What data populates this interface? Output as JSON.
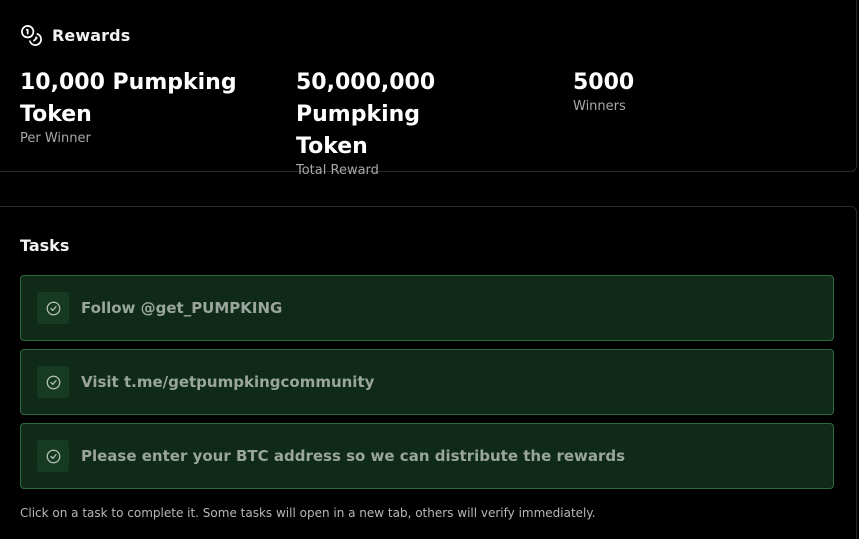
{
  "rewards": {
    "title": "Rewards",
    "icon": "coins-icon",
    "stats": [
      {
        "value_line1": "10,000 Pumpking",
        "value_line2": "Token",
        "label": "Per Winner"
      },
      {
        "value_line1": "50,000,000 Pumpking",
        "value_line2": "Token",
        "label": "Total Reward"
      },
      {
        "value_line1": "5000",
        "value_line2": "",
        "label": "Winners"
      }
    ]
  },
  "tasks": {
    "title": "Tasks",
    "items": [
      {
        "label": "Follow @get_PUMPKING",
        "icon": "check-circle-icon"
      },
      {
        "label": "Visit t.me/getpumpkingcommunity",
        "icon": "check-circle-icon"
      },
      {
        "label": "Please enter your BTC address so we can distribute the rewards",
        "icon": "check-circle-icon"
      }
    ],
    "footnote": "Click on a task to complete it. Some tasks will open in a new tab, others will verify immediately."
  },
  "colors": {
    "background": "#000000",
    "task_background": "#0f2a18",
    "task_border": "#2e6a40",
    "task_text": "#9aa59d",
    "muted_text": "#a8a8a8"
  }
}
